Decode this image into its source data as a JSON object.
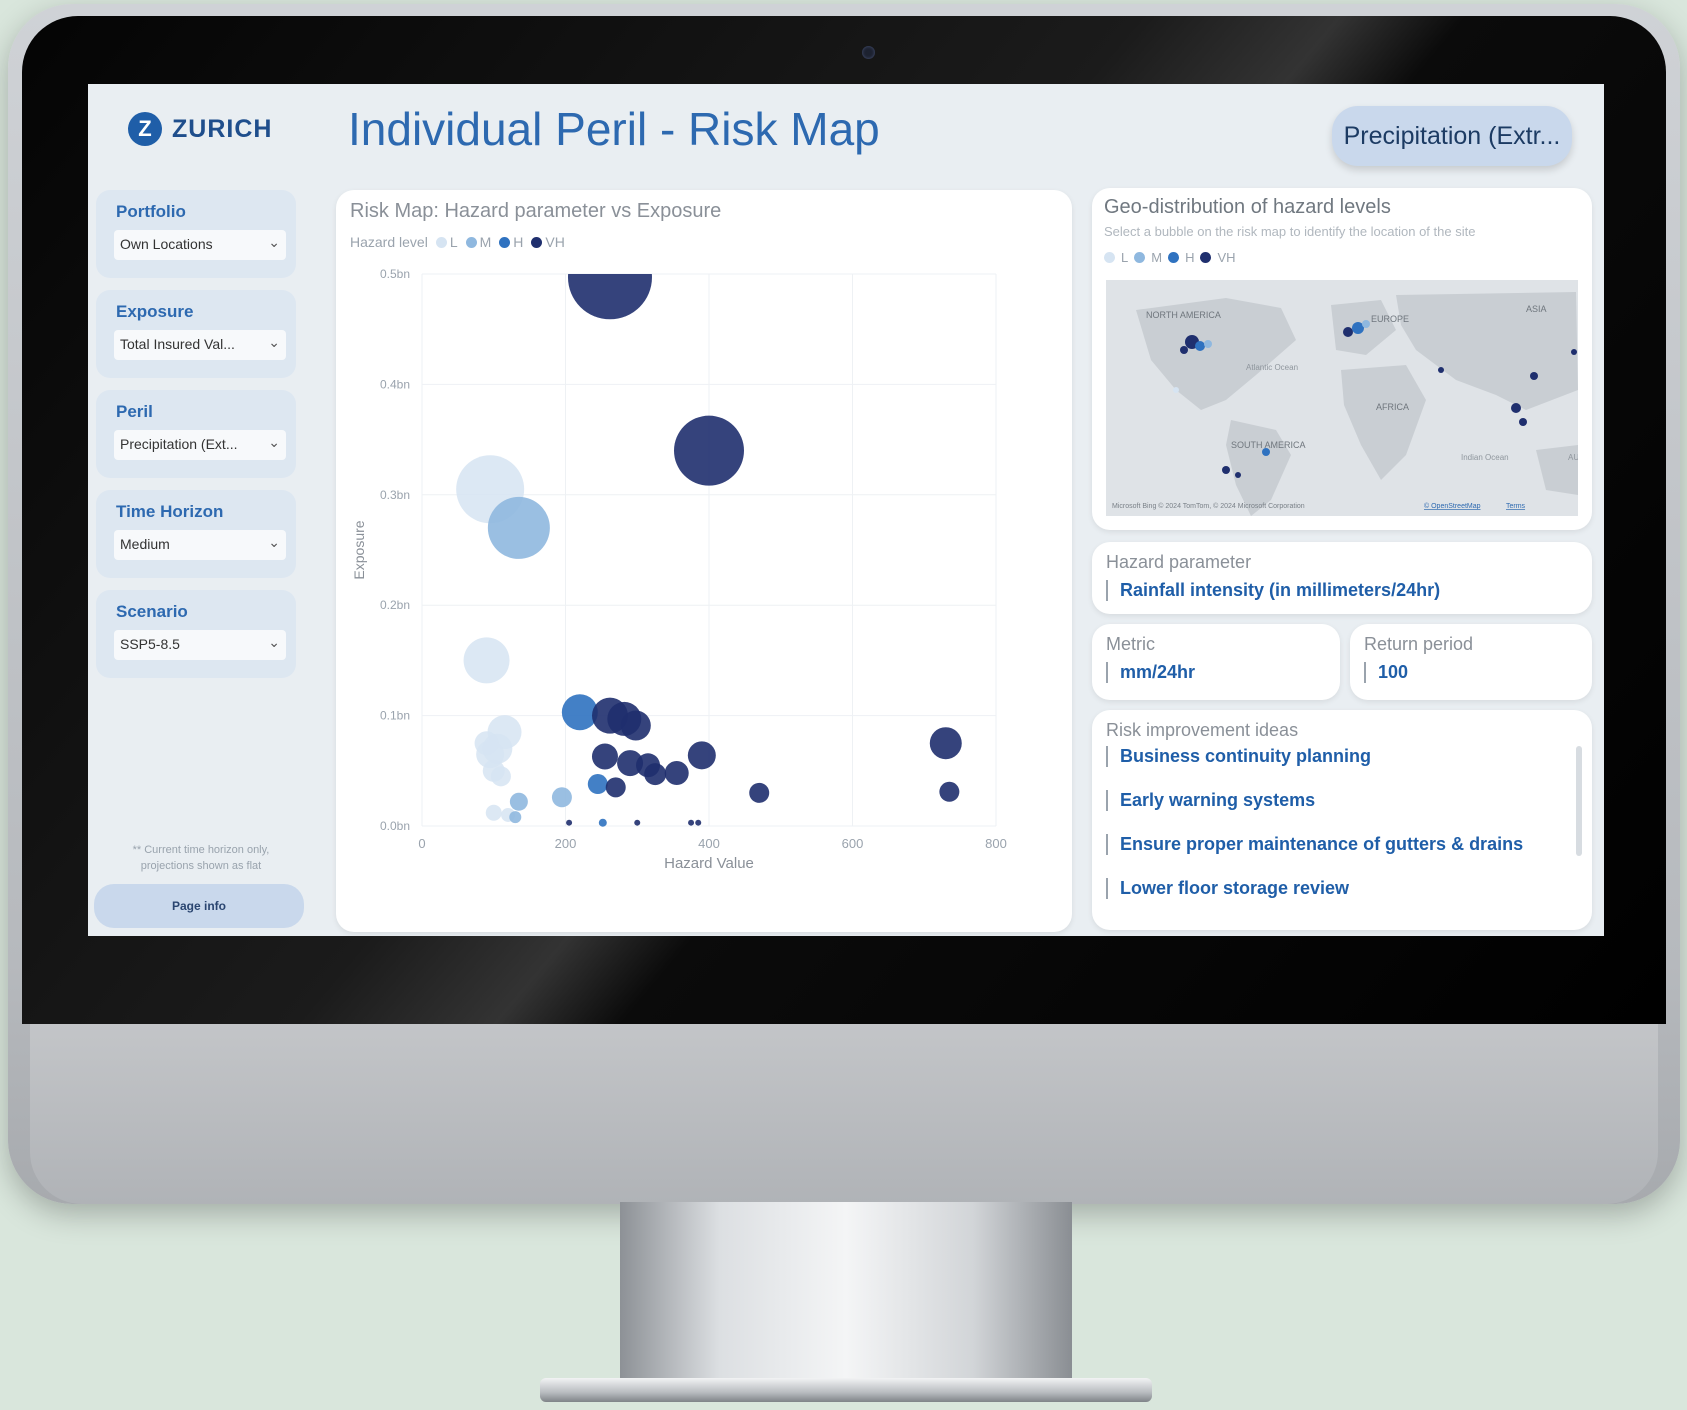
{
  "app": {
    "logo_text": "ZURICH",
    "logo_mark": "Z",
    "title": "Individual Peril - Risk Map",
    "peril_pill": "Precipitation (Extr..."
  },
  "filters": [
    {
      "label": "Portfolio",
      "value": "Own Locations"
    },
    {
      "label": "Exposure",
      "value": "Total Insured Val..."
    },
    {
      "label": "Peril",
      "value": "Precipitation (Ext..."
    },
    {
      "label": "Time Horizon",
      "value": "Medium"
    },
    {
      "label": "Scenario",
      "value": "SSP5-8.5"
    }
  ],
  "sidebar": {
    "note": "** Current time horizon only, projections shown as flat",
    "page_info": "Page info"
  },
  "chart": {
    "card_title": "Risk Map: Hazard parameter vs Exposure",
    "legend_title": "Hazard level",
    "legend": [
      {
        "label": "L",
        "color": "#d6e4f2"
      },
      {
        "label": "M",
        "color": "#8fb8df"
      },
      {
        "label": "H",
        "color": "#2f72c0"
      },
      {
        "label": "VH",
        "color": "#1f2f6e"
      }
    ]
  },
  "chart_data": {
    "type": "scatter",
    "title": "Risk Map: Hazard parameter vs Exposure",
    "xlabel": "Hazard Value",
    "ylabel": "Exposure",
    "xlim": [
      0,
      800
    ],
    "ylim": [
      0,
      0.5
    ],
    "x_ticks": [
      "0",
      "200",
      "400",
      "600",
      "800"
    ],
    "y_ticks": [
      "0.0bn",
      "0.1bn",
      "0.2bn",
      "0.3bn",
      "0.4bn",
      "0.5bn"
    ],
    "grid": true,
    "legend_position": "top-left",
    "series": [
      {
        "name": "L",
        "color": "#d6e4f2",
        "points": [
          {
            "x": 95,
            "y": 0.305,
            "size": 34
          },
          {
            "x": 90,
            "y": 0.15,
            "size": 23
          },
          {
            "x": 115,
            "y": 0.085,
            "size": 17
          },
          {
            "x": 105,
            "y": 0.07,
            "size": 15
          },
          {
            "x": 95,
            "y": 0.065,
            "size": 14
          },
          {
            "x": 90,
            "y": 0.075,
            "size": 12
          },
          {
            "x": 100,
            "y": 0.05,
            "size": 11
          },
          {
            "x": 110,
            "y": 0.045,
            "size": 10
          },
          {
            "x": 100,
            "y": 0.012,
            "size": 8
          },
          {
            "x": 120,
            "y": 0.01,
            "size": 7
          }
        ]
      },
      {
        "name": "M",
        "color": "#8fb8df",
        "points": [
          {
            "x": 135,
            "y": 0.27,
            "size": 31
          },
          {
            "x": 195,
            "y": 0.026,
            "size": 10
          },
          {
            "x": 135,
            "y": 0.022,
            "size": 9
          },
          {
            "x": 130,
            "y": 0.008,
            "size": 6
          }
        ]
      },
      {
        "name": "H",
        "color": "#2f72c0",
        "points": [
          {
            "x": 220,
            "y": 0.103,
            "size": 18
          },
          {
            "x": 245,
            "y": 0.038,
            "size": 10
          },
          {
            "x": 252,
            "y": 0.003,
            "size": 4
          }
        ]
      },
      {
        "name": "VH",
        "color": "#1f2f6e",
        "points": [
          {
            "x": 262,
            "y": 0.497,
            "size": 42
          },
          {
            "x": 400,
            "y": 0.34,
            "size": 35
          },
          {
            "x": 262,
            "y": 0.1,
            "size": 18
          },
          {
            "x": 282,
            "y": 0.097,
            "size": 17
          },
          {
            "x": 298,
            "y": 0.091,
            "size": 15
          },
          {
            "x": 255,
            "y": 0.063,
            "size": 13
          },
          {
            "x": 290,
            "y": 0.057,
            "size": 13
          },
          {
            "x": 315,
            "y": 0.055,
            "size": 12
          },
          {
            "x": 325,
            "y": 0.047,
            "size": 11
          },
          {
            "x": 355,
            "y": 0.048,
            "size": 12
          },
          {
            "x": 390,
            "y": 0.064,
            "size": 14
          },
          {
            "x": 270,
            "y": 0.035,
            "size": 10
          },
          {
            "x": 470,
            "y": 0.03,
            "size": 10
          },
          {
            "x": 730,
            "y": 0.075,
            "size": 16
          },
          {
            "x": 735,
            "y": 0.031,
            "size": 10
          },
          {
            "x": 205,
            "y": 0.003,
            "size": 3
          },
          {
            "x": 300,
            "y": 0.003,
            "size": 3
          },
          {
            "x": 375,
            "y": 0.003,
            "size": 3
          },
          {
            "x": 385,
            "y": 0.003,
            "size": 3
          }
        ]
      }
    ]
  },
  "geo": {
    "title": "Geo-distribution of hazard levels",
    "subtitle": "Select a bubble on the risk map to identify the location of the site",
    "legend": [
      "L",
      "M",
      "H",
      "VH"
    ],
    "regions": [
      "NORTH AMERICA",
      "EUROPE",
      "ASIA",
      "AFRICA",
      "SOUTH AMERICA",
      "Atlantic Ocean",
      "Indian Ocean",
      "AU"
    ],
    "attribution": "Microsoft Bing  © 2024 TomTom, © 2024 Microsoft Corporation",
    "attribution_link": "© OpenStreetMap",
    "terms": "Terms"
  },
  "hazard_parameter": {
    "label": "Hazard parameter",
    "value": "Rainfall intensity (in millimeters/24hr)"
  },
  "metric": {
    "label": "Metric",
    "value": "mm/24hr"
  },
  "return_period": {
    "label": "Return period",
    "value": "100"
  },
  "ideas": {
    "label": "Risk improvement ideas",
    "items": [
      "Business continuity planning",
      "Early warning systems",
      "Ensure proper maintenance of gutters & drains",
      "Lower floor storage review"
    ]
  },
  "colors": {
    "brand": "#2d69b0",
    "accent": "#1f5ea8",
    "background": "#e9eef2"
  }
}
